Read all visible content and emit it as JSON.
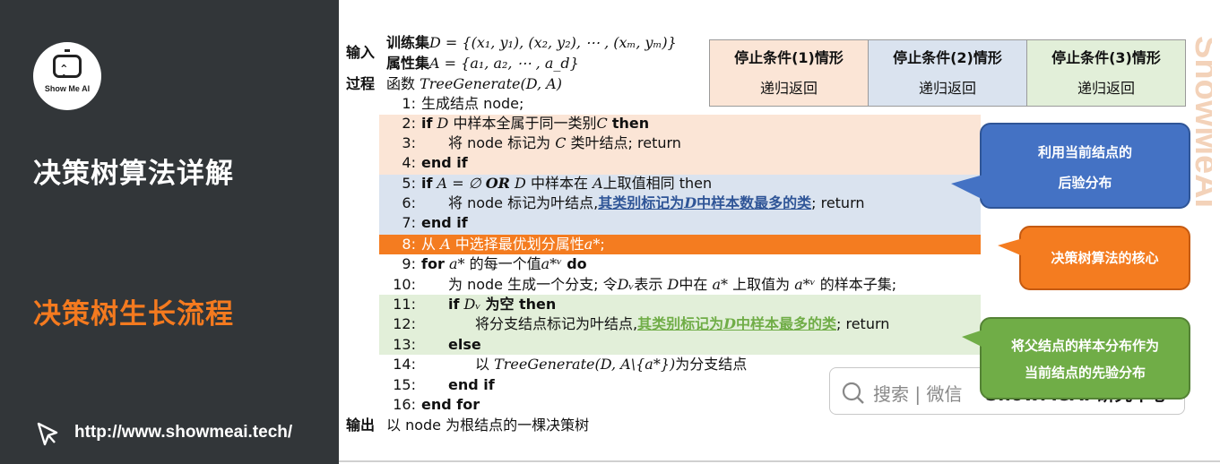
{
  "sidebar": {
    "logo_text": "Show Me AI",
    "title": "决策树算法详解",
    "subtitle": "决策树生长流程",
    "url": "http://www.showmeai.tech/",
    "cursor_icon": "cursor-click-icon"
  },
  "algorithm": {
    "input_label": "输入",
    "train_label": "训练集",
    "train_set": "D = {(x₁, y₁), (x₂, y₂), ⋯ , (xₘ, yₘ)}",
    "attr_label": "属性集",
    "attr_set": "A = {a₁, a₂, ⋯ , a_d}",
    "process_label": "过程",
    "process_text": "函数",
    "process_func": "TreeGenerate(D, A)",
    "lines": [
      {
        "num": "1:",
        "text": "生成结点 node;"
      },
      {
        "num": "2:",
        "kw": "if",
        "math": "D",
        "text": "中样本全属于同一类别",
        "math2": "C",
        "tail": "then"
      },
      {
        "num": "3:",
        "pre": "将 node 标记为",
        "math": "C",
        "text": "类叶结点; return"
      },
      {
        "num": "4:",
        "text": "end if"
      },
      {
        "num": "5:",
        "kw": "if",
        "math": "A = ∅",
        "bold_math": "OR",
        "math2": "D",
        "text": "中样本在",
        "math3": "A",
        "tail": "上取值相同 then"
      },
      {
        "num": "6:",
        "pre": "将 node 标记为叶结点,",
        "link_pre": "其类别标记为",
        "link_math": "D",
        "link_post": "中样本数最多的类",
        "tail": "; return"
      },
      {
        "num": "7:",
        "text": "end if"
      },
      {
        "num": "8:",
        "pre": "从",
        "math": "A",
        "text": "中选择最优划分属性",
        "math2": "a*",
        "tail": ";"
      },
      {
        "num": "9:",
        "pre": "for",
        "math": "a*",
        "text": "的每一个值",
        "math2": "a*ᵛ",
        "tail": "do"
      },
      {
        "num": "10:",
        "pre": "为 node 生成一个分支; 令",
        "math": "Dᵥ",
        "text": "表示",
        "math2": "D",
        "mid": "中在",
        "math3": "a*",
        "mid2": "上取值为",
        "math4": "a*ᵛ",
        "tail": "的样本子集;"
      },
      {
        "num": "11:",
        "pre": "if",
        "math": "Dᵥ",
        "text": "为空 then"
      },
      {
        "num": "12:",
        "pre": "将分支结点标记为叶结点,",
        "link_pre": "其类别标记为",
        "link_math": "D",
        "link_post": "中样本最多的类",
        "tail": "; return"
      },
      {
        "num": "13:",
        "text": "else"
      },
      {
        "num": "14:",
        "pre": "以",
        "math": "TreeGenerate(D, A\\{a*})",
        "text": "为分支结点"
      },
      {
        "num": "15:",
        "text": "end if"
      },
      {
        "num": "16:",
        "text": "end for"
      }
    ],
    "output_label": "输出",
    "output_text": "以 node 为根结点的一棵决策树"
  },
  "conditions": [
    {
      "title": "停止条件(1)情形",
      "action": "递归返回"
    },
    {
      "title": "停止条件(2)情形",
      "action": "递归返回"
    },
    {
      "title": "停止条件(3)情形",
      "action": "递归返回"
    }
  ],
  "callouts": {
    "blue": [
      "利用当前结点的",
      "后验分布"
    ],
    "orange": "决策树算法的核心",
    "green": [
      "将父结点的样本分布作为",
      "当前结点的先验分布"
    ]
  },
  "search_badge": {
    "text": "搜索 | 微信",
    "brand": "ShowMeAI 研究中心"
  },
  "watermark": "ShowMeAI",
  "colors": {
    "panel_bg": "#323639",
    "accent_orange": "#f47c20",
    "band_peach": "#fbe5d6",
    "band_blue": "#dae3ef",
    "band_green": "#e2efd9",
    "callout_blue": "#4472c4",
    "callout_green": "#70ad47"
  }
}
